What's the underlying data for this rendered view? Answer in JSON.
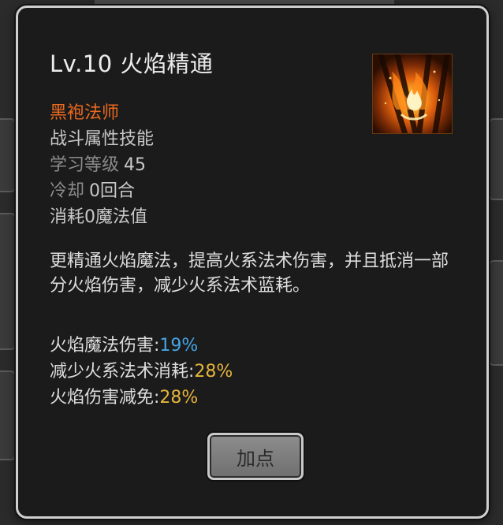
{
  "tooltip": {
    "title": "Lv.10 火焰精通",
    "class_name": "黑袍法师",
    "skill_type": "战斗属性技能",
    "learn_level_label": "学习等级",
    "learn_level_value": "45",
    "cooldown_label": "冷却",
    "cooldown_value": "0回合",
    "cost": "消耗0魔法值",
    "description": "更精通火焰魔法，提高火系法术伤害，并且抵消一部分火焰伤害，减少火系法术蓝耗。",
    "stats": [
      {
        "label": "火焰魔法伤害:",
        "value": "19%",
        "color": "#46a6e6"
      },
      {
        "label": "减少火系法术消耗:",
        "value": "28%",
        "color": "#e6b53c"
      },
      {
        "label": "火焰伤害减免:",
        "value": "28%",
        "color": "#e6b53c"
      }
    ],
    "add_button_label": "加点",
    "icon": "fire-mastery-icon"
  },
  "colors": {
    "class_name": "#ec6a1e",
    "stat_blue": "#46a6e6",
    "stat_gold": "#e6b53c",
    "panel_border": "#cfcfcf",
    "panel_bg": "#1b1b1b"
  }
}
